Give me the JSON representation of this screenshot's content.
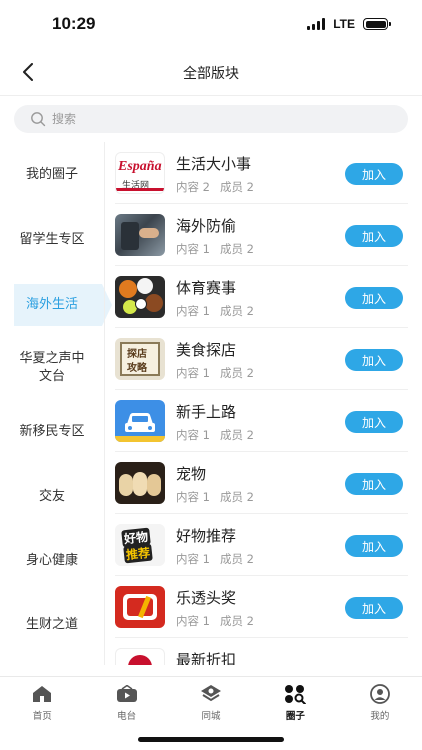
{
  "status_bar": {
    "time": "10:29",
    "network": "LTE"
  },
  "header": {
    "title": "全部版块"
  },
  "search": {
    "placeholder": "搜索"
  },
  "sidebar": {
    "items": [
      {
        "label": "我的圈子",
        "active": false
      },
      {
        "label": "留学生专区",
        "active": false
      },
      {
        "label": "海外生活",
        "active": true
      },
      {
        "label": "华夏之声中文台",
        "active": false
      },
      {
        "label": "新移民专区",
        "active": false
      },
      {
        "label": "交友",
        "active": false
      },
      {
        "label": "身心健康",
        "active": false
      },
      {
        "label": "生财之道",
        "active": false
      }
    ]
  },
  "list": {
    "rows": [
      {
        "title": "生活大小事",
        "content": "内容 2",
        "members": "成员 2",
        "join": "加入",
        "thumb_text_1": "España",
        "thumb_text_2": "生活网"
      },
      {
        "title": "海外防偷",
        "content": "内容 1",
        "members": "成员 2",
        "join": "加入"
      },
      {
        "title": "体育赛事",
        "content": "内容 1",
        "members": "成员 2",
        "join": "加入"
      },
      {
        "title": "美食探店",
        "content": "内容 1",
        "members": "成员 2",
        "join": "加入",
        "thumb_text_1": "探店",
        "thumb_text_2": "攻略"
      },
      {
        "title": "新手上路",
        "content": "内容 1",
        "members": "成员 2",
        "join": "加入"
      },
      {
        "title": "宠物",
        "content": "内容 1",
        "members": "成员 2",
        "join": "加入"
      },
      {
        "title": "好物推荐",
        "content": "内容 1",
        "members": "成员 2",
        "join": "加入",
        "thumb_text_1": "好物",
        "thumb_text_2": "推荐"
      },
      {
        "title": "乐透头奖",
        "content": "内容 1",
        "members": "成员 2",
        "join": "加入"
      },
      {
        "title": "最新折扣",
        "content": "",
        "members": "",
        "join": ""
      }
    ]
  },
  "tabbar": {
    "tabs": [
      {
        "label": "首页",
        "icon": "home-icon",
        "active": false
      },
      {
        "label": "电台",
        "icon": "radio-icon",
        "active": false
      },
      {
        "label": "同城",
        "icon": "city-icon",
        "active": false
      },
      {
        "label": "圈子",
        "icon": "circle-icon",
        "active": true
      },
      {
        "label": "我的",
        "icon": "profile-icon",
        "active": false
      }
    ]
  },
  "colors": {
    "accent": "#2ea7e6",
    "active_bg": "#e6f3fb",
    "active_text": "#2a9fe0"
  }
}
